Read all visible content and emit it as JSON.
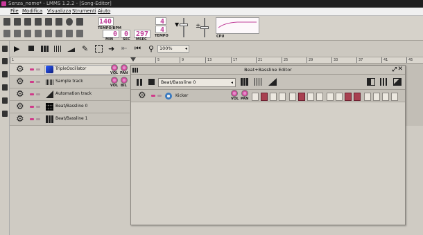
{
  "window": {
    "title": "Senza_nome* - LMMS 1.2.2 - [Song-Editor]"
  },
  "menu": [
    "File",
    "Modifica",
    "Visualizza",
    "Strumenti",
    "Aiuto"
  ],
  "transport": {
    "tempo_value": "140",
    "tempo_label": "TEMPO/BPM",
    "min_value": "0",
    "min_label": "MIN",
    "sec_value": "0",
    "sec_label": "SEC",
    "msec_value": "297",
    "msec_label": "MSEC",
    "timesig_top": "4",
    "timesig_bottom": "4",
    "timesig_label": "TEMPO",
    "cpu_label": "CPU"
  },
  "song_toolbar": {
    "zoom_value": "100%"
  },
  "ruler": [
    "1",
    "5",
    "9",
    "13",
    "17",
    "21",
    "25",
    "29",
    "33",
    "37",
    "41",
    "45"
  ],
  "knob_labels": {
    "vol": "VOL",
    "pan": "PAN",
    "bil": "BIL"
  },
  "tracks": [
    {
      "name": "TripleOscillator",
      "icon": "triple-oscillator-icon",
      "knob2": "PAN"
    },
    {
      "name": "Sample track",
      "icon": "waveform-icon",
      "knob2": "BIL"
    },
    {
      "name": "Automation track",
      "icon": "automation-icon",
      "knob2": ""
    },
    {
      "name": "Beat/Bassline 0",
      "icon": "beat-grid-icon",
      "knob2": ""
    },
    {
      "name": "Beat/Bassline 1",
      "icon": "beat-grid-icon",
      "knob2": ""
    }
  ],
  "bb_editor": {
    "title": "Beat+Bassline Editor",
    "selector_value": "Beat/Bassline 0",
    "instrument": "Kicker",
    "steps": [
      0,
      1,
      0,
      0,
      0,
      1,
      0,
      0,
      0,
      0,
      1,
      1,
      0,
      0,
      0,
      0
    ]
  },
  "colors": {
    "accent": "#d03a8a",
    "lcd_digits": "#c0409a",
    "step_on": "#a84050"
  }
}
